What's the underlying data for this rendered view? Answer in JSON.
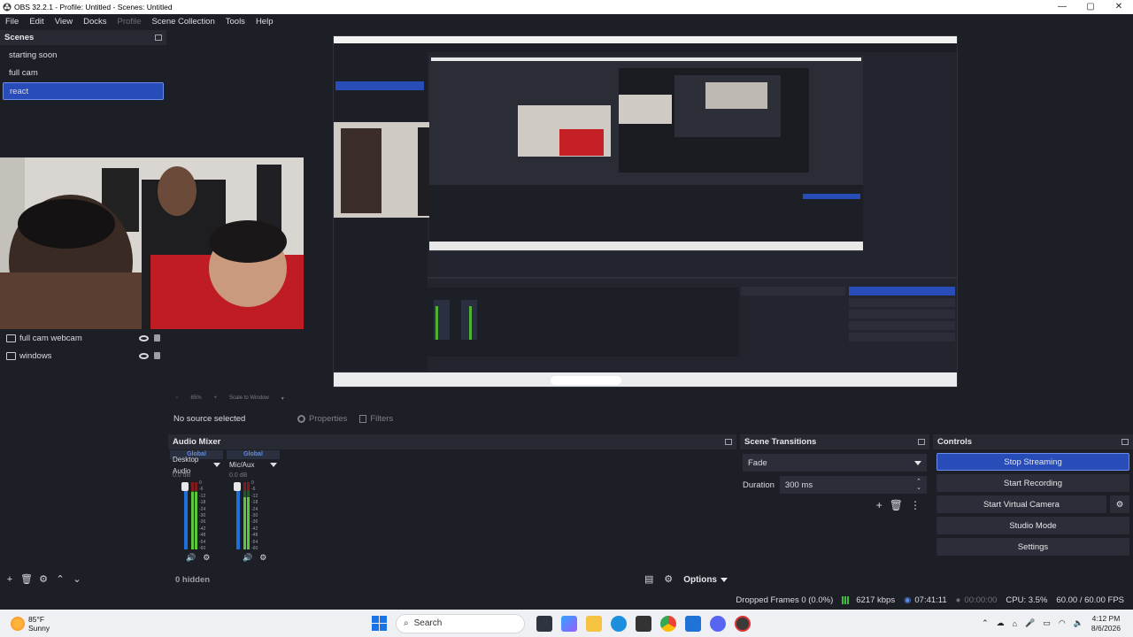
{
  "window": {
    "title": "OBS 32.2.1 - Profile: Untitled - Scenes: Untitled",
    "min": "—",
    "max": "▢",
    "close": "✕"
  },
  "menu": [
    {
      "label": "File"
    },
    {
      "label": "Edit"
    },
    {
      "label": "View"
    },
    {
      "label": "Docks"
    },
    {
      "label": "Profile",
      "disabled": true
    },
    {
      "label": "Scene Collection"
    },
    {
      "label": "Tools"
    },
    {
      "label": "Help"
    }
  ],
  "scenes": {
    "title": "Scenes",
    "items": [
      {
        "label": "starting soon"
      },
      {
        "label": "full cam"
      },
      {
        "label": "react",
        "active": true
      }
    ]
  },
  "sources": {
    "items": [
      {
        "label": "full cam webcam",
        "icon": "camera-icon"
      },
      {
        "label": "windows",
        "icon": "window-icon"
      }
    ]
  },
  "preview": {
    "zoom": "65%",
    "scale": "Scale to Window"
  },
  "source_bar": {
    "no_source": "No source selected",
    "properties": "Properties",
    "filters": "Filters"
  },
  "mixer": {
    "title": "Audio Mixer",
    "channels": [
      {
        "global": "Global",
        "name": "Desktop Audio",
        "db": "0.0 dB",
        "level": 0.85
      },
      {
        "global": "Global",
        "name": "Mic/Aux",
        "db": "0.0 dB",
        "level": 0.78
      }
    ],
    "scale": [
      "0",
      "-6",
      "-12",
      "-18",
      "-24",
      "-30",
      "-36",
      "-42",
      "-48",
      "-54",
      "-60"
    ],
    "hidden": "0 hidden",
    "options": "Options"
  },
  "transitions": {
    "title": "Scene Transitions",
    "selected": "Fade",
    "duration_label": "Duration",
    "duration_value": "300 ms"
  },
  "controls": {
    "title": "Controls",
    "stop_streaming": "Stop Streaming",
    "start_recording": "Start Recording",
    "start_virtual_camera": "Start Virtual Camera",
    "studio_mode": "Studio Mode",
    "settings": "Settings"
  },
  "status": {
    "dropped": "Dropped Frames 0 (0.0%)",
    "bitrate": "6217 kbps",
    "stream_time": "07:41:11",
    "rec_time": "00:00:00",
    "cpu": "CPU: 3.5%",
    "fps": "60.00 / 60.00 FPS"
  },
  "taskbar": {
    "temp": "85°F",
    "weather": "Sunny",
    "search": "Search",
    "time": "4:12 PM",
    "date": "8/6/2026"
  },
  "colors": {
    "accent": "#284cb8",
    "panel": "#1d1f26"
  }
}
